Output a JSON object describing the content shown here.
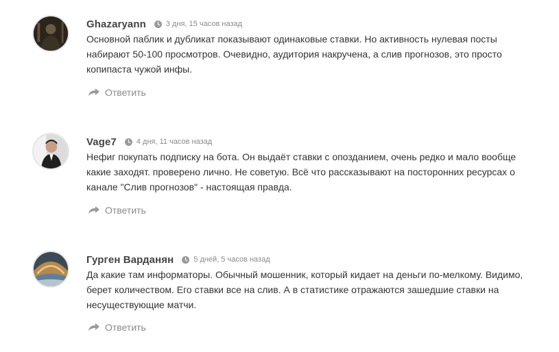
{
  "colors": {
    "meta": "#8a8a8a",
    "author": "#444444",
    "text": "#333333",
    "avatar_border": "#e6e6e6"
  },
  "reply_icon": "reply-arrow-icon",
  "time_icon": "clock-icon",
  "comments": [
    {
      "author": "Ghazaryann",
      "time": "3 дня, 15 часов назад",
      "text": "Основной паблик и дубликат показывают одинаковые ставки. Но активность нулевая посты набирают 50-100 просмотров. Очевидно, аудитория накручена, а слив прогнозов, это просто копипаста чужой инфы.",
      "reply_label": "Ответить"
    },
    {
      "author": "Vage7",
      "time": "4 дня, 11 часов назад",
      "text": "Нефиг покупать подписку на бота. Он выдаёт ставки с опозданием, очень редко и мало вообще какие заходят. проверено лично. Не советую. Всё что рассказывают на посторонних ресурсах о канале \"Слив прогнозов\" - настоящая правда.",
      "reply_label": "Ответить"
    },
    {
      "author": "Гурген Варданян",
      "time": "5 дней, 5 часов назад",
      "text": "Да какие там информаторы. Обычный мошенник, который кидает на деньги по-мелкому. Видимо, берет количеством. Его ставки все на слив. А в статистике отражаются зашедшие ставки на несуществующие матчи.",
      "reply_label": "Ответить"
    }
  ]
}
